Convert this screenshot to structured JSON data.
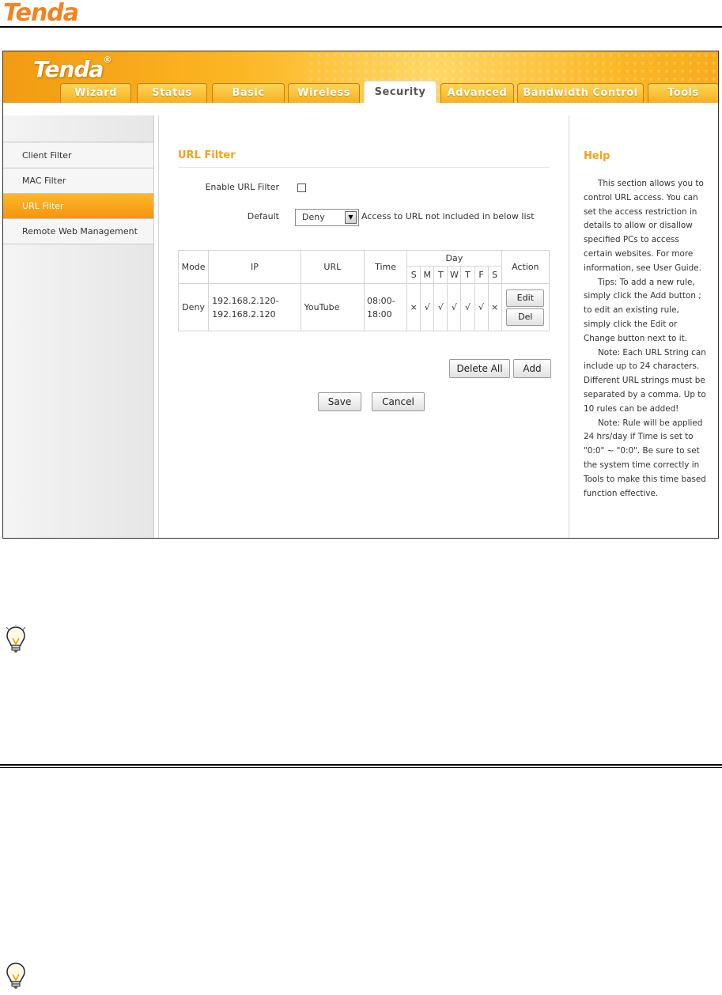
{
  "doc": {
    "logo_text": "Tenda"
  },
  "app": {
    "logo_text": "Tenda",
    "logo_mark": "®"
  },
  "tabs": [
    {
      "label": "Wizard",
      "active": false
    },
    {
      "label": "Status",
      "active": false
    },
    {
      "label": "Basic",
      "active": false
    },
    {
      "label": "Wireless",
      "active": false
    },
    {
      "label": "Security",
      "active": true
    },
    {
      "label": "Advanced",
      "active": false
    },
    {
      "label": "Bandwidth Control",
      "active": false
    },
    {
      "label": "Tools",
      "active": false
    }
  ],
  "sidebar": {
    "items": [
      {
        "label": "Client Filter",
        "active": false
      },
      {
        "label": "MAC Filter",
        "active": false
      },
      {
        "label": "URL Filter",
        "active": true
      },
      {
        "label": "Remote Web Management",
        "active": false
      }
    ]
  },
  "main": {
    "title": "URL Filter",
    "enable_label": "Enable URL Filter",
    "enable_checked": false,
    "default_label": "Default",
    "default_value": "Deny",
    "default_note": "Access to URL not included in below list",
    "table": {
      "headers": {
        "mode": "Mode",
        "ip": "IP",
        "url": "URL",
        "time": "Time",
        "day": "Day",
        "action": "Action"
      },
      "days": [
        "S",
        "M",
        "T",
        "W",
        "T",
        "F",
        "S"
      ],
      "rows": [
        {
          "mode": "Deny",
          "ip_start": "192.168.2.120-",
          "ip_end": "192.168.2.120",
          "url": "YouTube",
          "time_start": "08:00-",
          "time_end": "18:00",
          "day_marks": [
            "×",
            "√",
            "√",
            "√",
            "√",
            "√",
            "×"
          ],
          "edit_label": "Edit",
          "del_label": "Del"
        }
      ]
    },
    "delete_all_label": "Delete All",
    "add_label": "Add",
    "save_label": "Save",
    "cancel_label": "Cancel"
  },
  "help": {
    "title": "Help",
    "paragraphs": [
      "This section allows you to control URL access. You can set the access restriction in details to allow or disallow specified PCs to access certain websites. For more information, see User Guide.",
      "Tips: To add a new rule, simply click the Add button ; to edit an existing rule, simply click the Edit or Change button next to it.",
      "Note: Each URL String can include up to 24 characters. Different URL strings must be separated by a comma. Up to 10 rules can be added!",
      "Note: Rule will be applied 24 hrs/day if Time is set to \"0:0\" ~ \"0:0\". Be sure to set the system time correctly in Tools to make this time based function effective."
    ]
  },
  "colors": {
    "brand": "#f58220",
    "accent": "#f5a01a",
    "active_tab": "#ffffff",
    "active_side": "#f39511"
  },
  "icons": [
    "lightbulb-icon",
    "dropdown-arrow-icon",
    "checkbox-icon"
  ]
}
